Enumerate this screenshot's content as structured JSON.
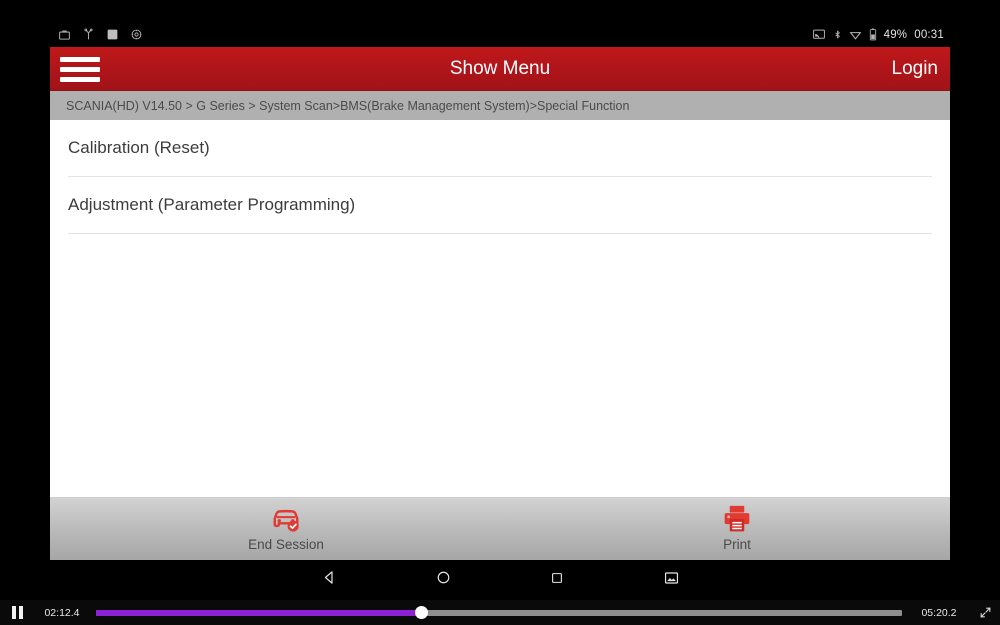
{
  "status_bar": {
    "left_icons": [
      "briefcase-icon",
      "usb-debug-icon",
      "app-square-icon",
      "settings-gear-icon"
    ],
    "right_icons": [
      "cast-screen-icon",
      "bluetooth-icon",
      "wifi-icon",
      "battery-icon"
    ],
    "battery_percent": "49%",
    "clock": "00:31"
  },
  "titlebar": {
    "menu_icon": "hamburger-menu-icon",
    "title": "Show Menu",
    "login_label": "Login",
    "background_color": "#b0151a"
  },
  "breadcrumb": {
    "path": "SCANIA(HD) V14.50 > G Series > System Scan>BMS(Brake Management System)>Special Function"
  },
  "menu": {
    "items": [
      {
        "label": "Calibration (Reset)"
      },
      {
        "label": "Adjustment (Parameter Programming)"
      }
    ]
  },
  "function_bar": {
    "end_session": {
      "label": "End Session",
      "icon": "car-check-icon",
      "color": "#e03a32"
    },
    "print": {
      "label": "Print",
      "icon": "printer-icon",
      "color": "#e03a32"
    }
  },
  "nav_bar": {
    "back": "back-triangle-icon",
    "home": "home-circle-icon",
    "recents": "recents-square-icon",
    "screenshot": "screenshot-image-icon"
  },
  "player": {
    "state_icon": "pause-icon",
    "current_time": "02:12.4",
    "total_time": "05:20.2",
    "progress_percent": 40.4,
    "accent_color": "#8d21d6",
    "fullscreen_icon": "expand-icon"
  }
}
